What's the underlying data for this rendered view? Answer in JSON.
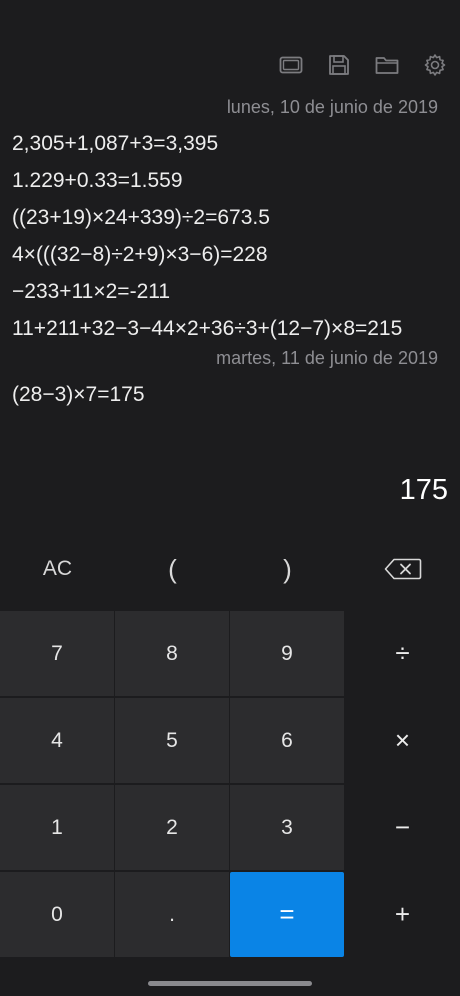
{
  "toolbar": {
    "icons": [
      "screen-icon",
      "save-icon",
      "folder-icon",
      "gear-icon"
    ]
  },
  "history": {
    "groups": [
      {
        "date": "lunes, 10 de junio de 2019",
        "entries": [
          "2,305+1,087+3=3,395",
          "1.229+0.33=1.559",
          "((23+19)×24+339)÷2=673.5",
          "4×(((32−8)÷2+9)×3−6)=228",
          "−233+11×2=-211",
          "11+211+32−3−44×2+36÷3+(12−7)×8=215"
        ]
      },
      {
        "date": "martes, 11 de junio de 2019",
        "entries": [
          "(28−3)×7=175"
        ]
      }
    ]
  },
  "display": {
    "value": "175"
  },
  "functions": {
    "clear": "AC",
    "open_paren": "(",
    "close_paren": ")"
  },
  "keys": {
    "k7": "7",
    "k8": "8",
    "k9": "9",
    "divide": "÷",
    "k4": "4",
    "k5": "5",
    "k6": "6",
    "multiply": "×",
    "k1": "1",
    "k2": "2",
    "k3": "3",
    "minus": "−",
    "k0": "0",
    "dot": ".",
    "equals": "=",
    "plus": "+"
  },
  "colors": {
    "background": "#1c1c1e",
    "key": "#2c2c2e",
    "accent": "#0a84e6",
    "muted_text": "#8e8e93"
  }
}
